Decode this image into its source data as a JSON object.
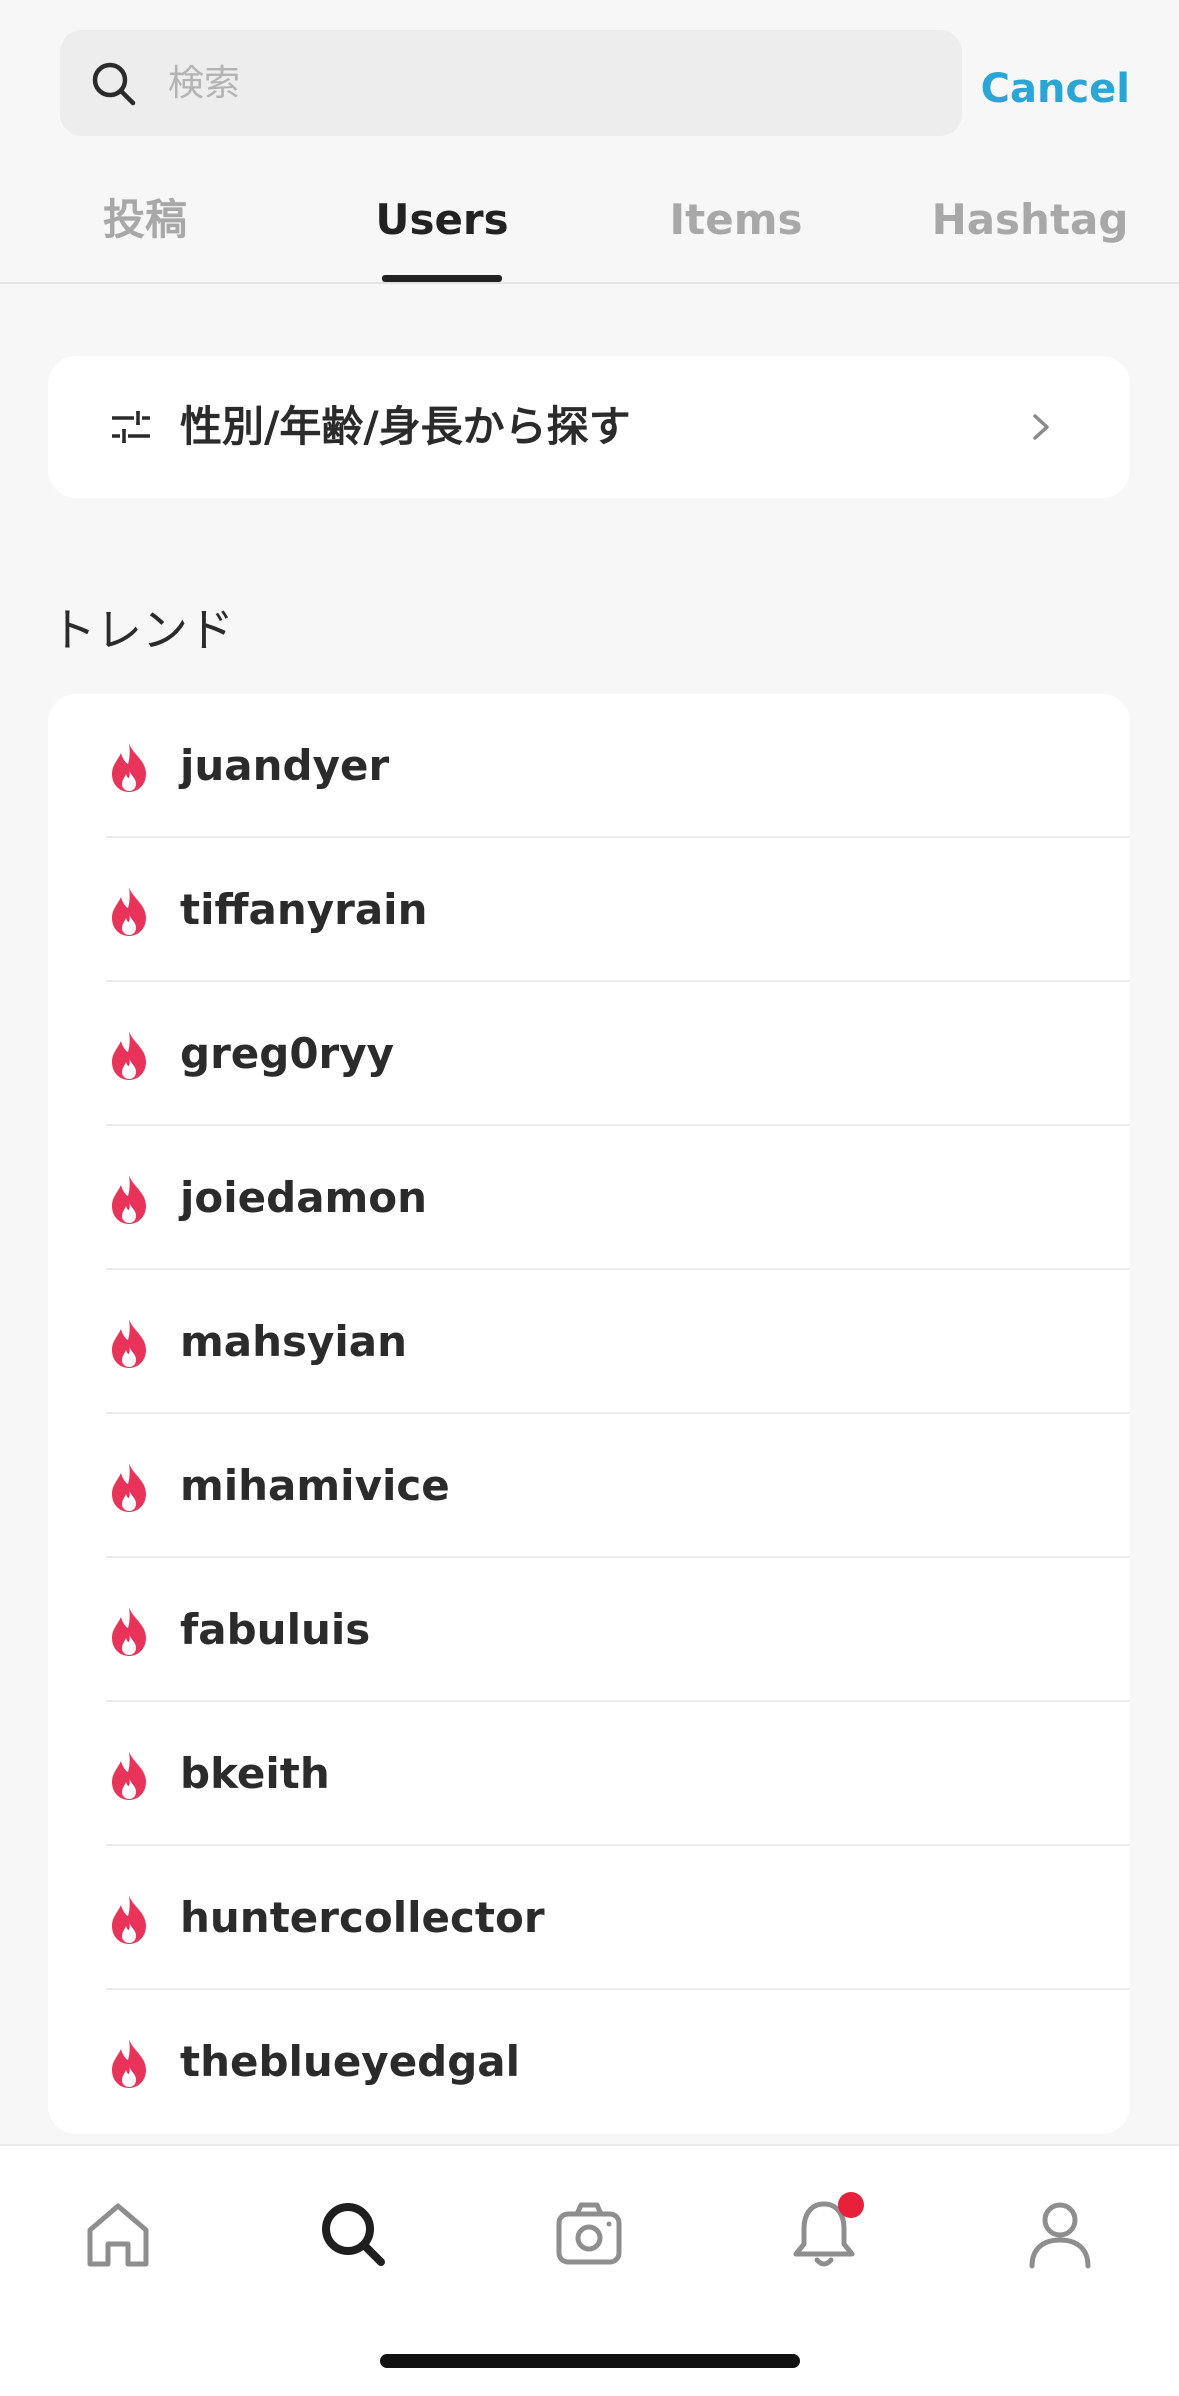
{
  "search": {
    "placeholder": "検索",
    "value": "",
    "cancel_label": "Cancel"
  },
  "tabs": [
    {
      "label": "投稿",
      "active": false
    },
    {
      "label": "Users",
      "active": true
    },
    {
      "label": "Items",
      "active": false
    },
    {
      "label": "Hashtag",
      "active": false
    }
  ],
  "filter": {
    "label": "性別/年齢/身長から探す",
    "icon": "sliders-icon"
  },
  "trend": {
    "title": "トレンド",
    "icon": "flame-icon",
    "icon_color": "#e8345a",
    "items": [
      {
        "name": "juandyer"
      },
      {
        "name": "tiffanyrain"
      },
      {
        "name": "greg0ryy"
      },
      {
        "name": "joiedamon"
      },
      {
        "name": "mahsyian"
      },
      {
        "name": "mihamivice"
      },
      {
        "name": "fabuluis"
      },
      {
        "name": "bkeith"
      },
      {
        "name": "huntercollector"
      },
      {
        "name": "theblueyedgal"
      }
    ]
  },
  "tabbar": {
    "items": [
      {
        "icon": "home-icon",
        "active": false
      },
      {
        "icon": "search-icon",
        "active": true
      },
      {
        "icon": "camera-icon",
        "active": false
      },
      {
        "icon": "bell-icon",
        "active": false,
        "badge": true
      },
      {
        "icon": "profile-icon",
        "active": false
      }
    ],
    "badge_color": "#e8203a"
  },
  "colors": {
    "accent": "#2aa6d6",
    "background": "#f7f7f7"
  }
}
